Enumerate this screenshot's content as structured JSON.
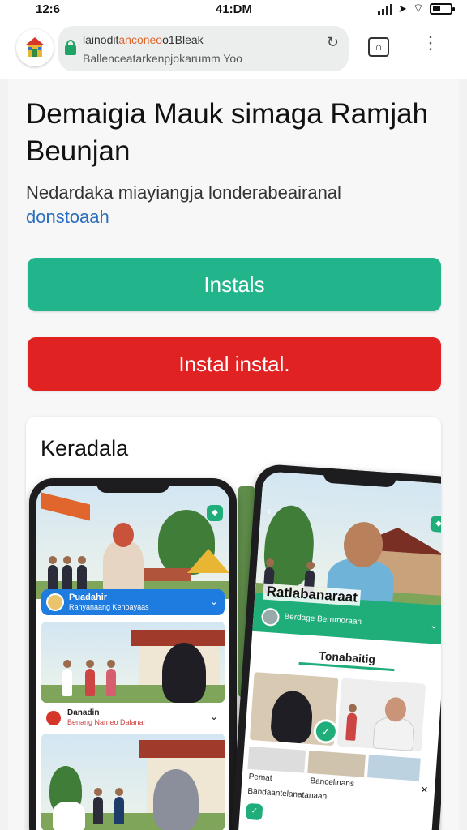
{
  "status_bar": {
    "time_left": "12:6",
    "time_center": "41:DM"
  },
  "browser": {
    "url_line1_prefix": "lainodit",
    "url_line1_highlight": "anconeo",
    "url_line1_suffix": "o1Bleak",
    "url_line2": "Ballenceatarkenpjokarumm Yoo",
    "icons": [
      "site-logo-icon",
      "lock-icon",
      "reload-icon",
      "tabs-icon",
      "more-vert-icon"
    ]
  },
  "page": {
    "title": "Demaigia Mauk simaga Ramjah Beunjan",
    "subtitle": "Nedardaka miayiangja londerabeairanal",
    "subtitle_link": "donstoaah",
    "primary_button": "Instals",
    "secondary_button": "Instal instal."
  },
  "gallery": {
    "title": "Keradala",
    "phone1": {
      "banner_title": "Puadahir",
      "banner_sub": "Ranyanaang Kenoayaas",
      "item_title": "Danadin",
      "item_sub": "Benang Nameo Dalanar"
    },
    "phone2": {
      "header_title": "Ratlabanaraat",
      "header_sub": "Berdage Bernmoraan",
      "section_title": "Tonabaitig",
      "caption_left": "Pemat",
      "caption_right": "Bancelinans",
      "caption_bottom": "Bandaantelanatanaan"
    }
  },
  "colors": {
    "primary": "#22b48b",
    "danger": "#e02222",
    "link": "#2a6ebd",
    "banner_blue": "#1e7be0",
    "app_green": "#1fae7a"
  }
}
